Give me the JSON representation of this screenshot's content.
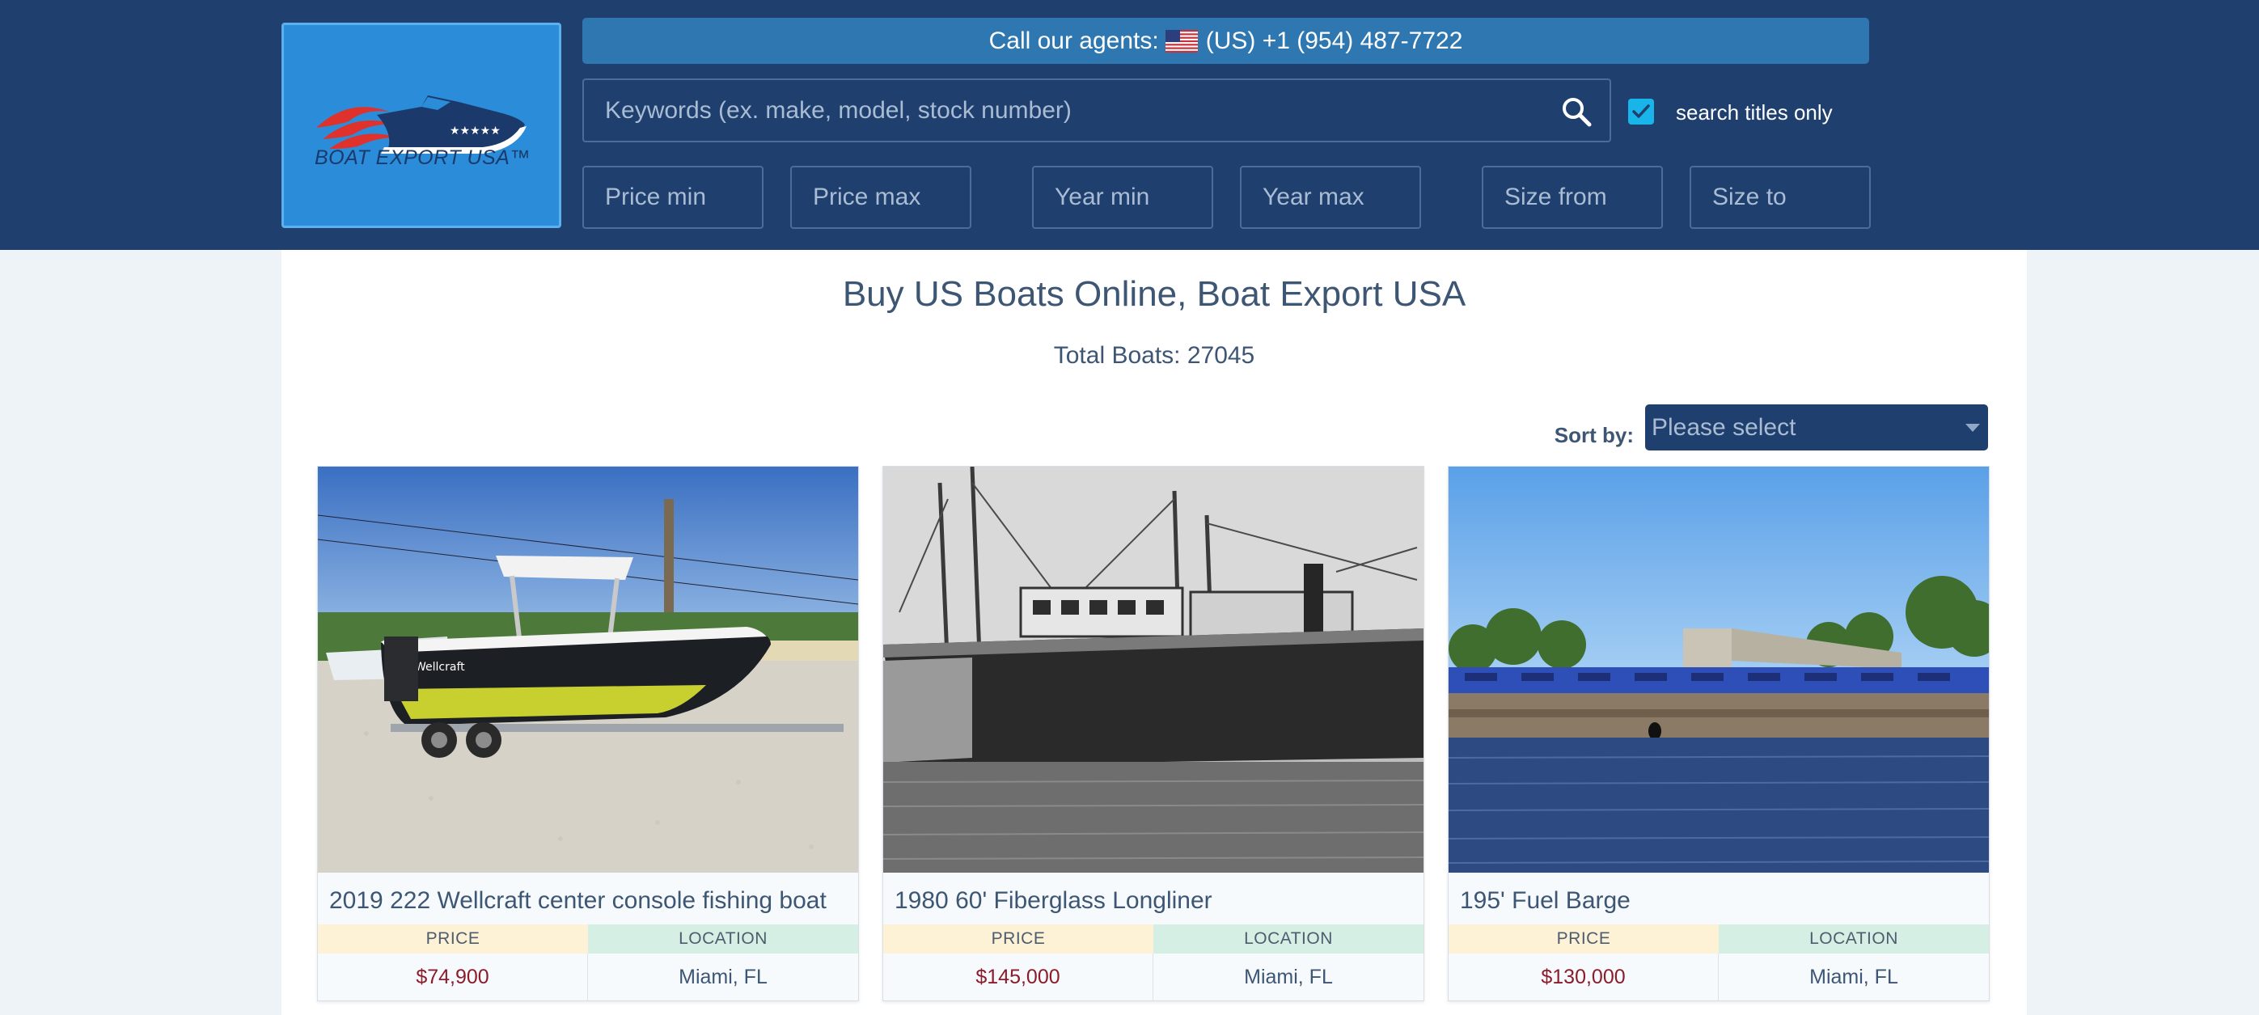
{
  "header": {
    "logo_text": "BOAT EXPORT USA™",
    "call_label": "Call our agents:",
    "call_number": "(US) +1 (954) 487-7722",
    "search_placeholder": "Keywords (ex. make, model, stock number)",
    "search_titles_only_label": "search titles only",
    "search_titles_only_checked": true,
    "filters": {
      "price_min": "Price min",
      "price_max": "Price max",
      "year_min": "Year min",
      "year_max": "Year max",
      "size_from": "Size from",
      "size_to": "Size to"
    }
  },
  "main": {
    "title": "Buy US Boats Online, Boat Export USA",
    "total_label": "Total Boats: 27045",
    "sort_label": "Sort by:",
    "sort_value": "Please select"
  },
  "listings": [
    {
      "title": "2019 222 Wellcraft center console fishing boat",
      "price_label": "PRICE",
      "location_label": "LOCATION",
      "price": "$74,900",
      "location": "Miami, FL"
    },
    {
      "title": "1980 60' Fiberglass Longliner",
      "price_label": "PRICE",
      "location_label": "LOCATION",
      "price": "$145,000",
      "location": "Miami, FL"
    },
    {
      "title": "195' Fuel Barge",
      "price_label": "PRICE",
      "location_label": "LOCATION",
      "price": "$130,000",
      "location": "Miami, FL"
    }
  ],
  "colors": {
    "header_bg": "#1f3f6e",
    "logo_bg": "#2b8cd9",
    "call_bar_bg": "#2f77b0",
    "checkbox": "#18b4ea",
    "price_text": "#8a1c2b",
    "price_label_bg": "#fdf1d6",
    "location_label_bg": "#d6efe4"
  },
  "icons": {
    "search": "search-icon",
    "checkbox": "checkmark-icon",
    "flag": "us-flag-icon",
    "sort_caret": "caret-down-icon"
  }
}
